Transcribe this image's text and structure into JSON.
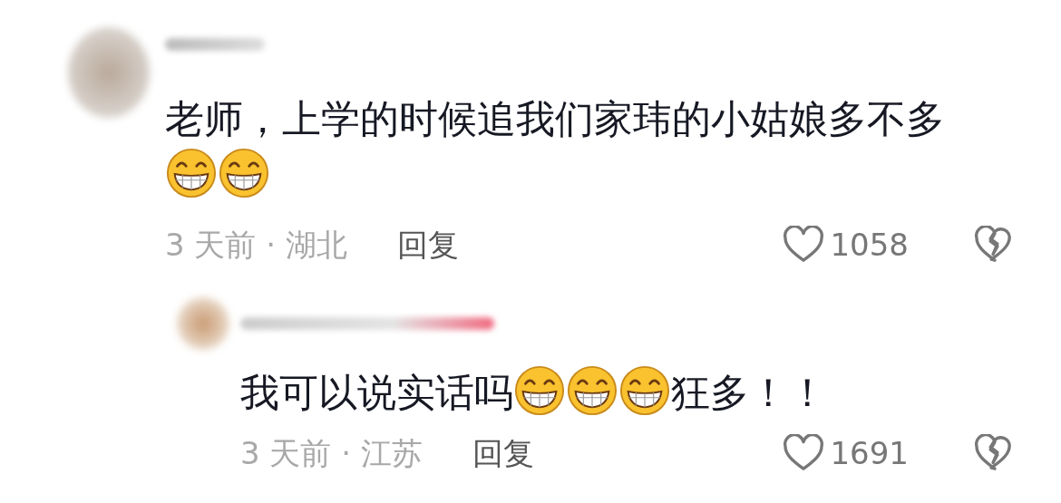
{
  "comments": [
    {
      "kind": "comment",
      "content": [
        {
          "kind": "text",
          "text": "老师，上学的时候追我们家玮的小姑娘多不多"
        },
        {
          "kind": "emoji"
        },
        {
          "kind": "emoji"
        }
      ],
      "meta": "3 天前 · 湖北",
      "reply_label": "回复",
      "likes": "1058"
    },
    {
      "kind": "reply",
      "content": [
        {
          "kind": "text",
          "text": "我可以说实话吗"
        },
        {
          "kind": "emoji"
        },
        {
          "kind": "emoji"
        },
        {
          "kind": "emoji"
        },
        {
          "kind": "text",
          "text": "狂多！！"
        }
      ],
      "meta": "3 天前 · 江苏",
      "reply_label": "回复",
      "likes": "1691"
    }
  ]
}
